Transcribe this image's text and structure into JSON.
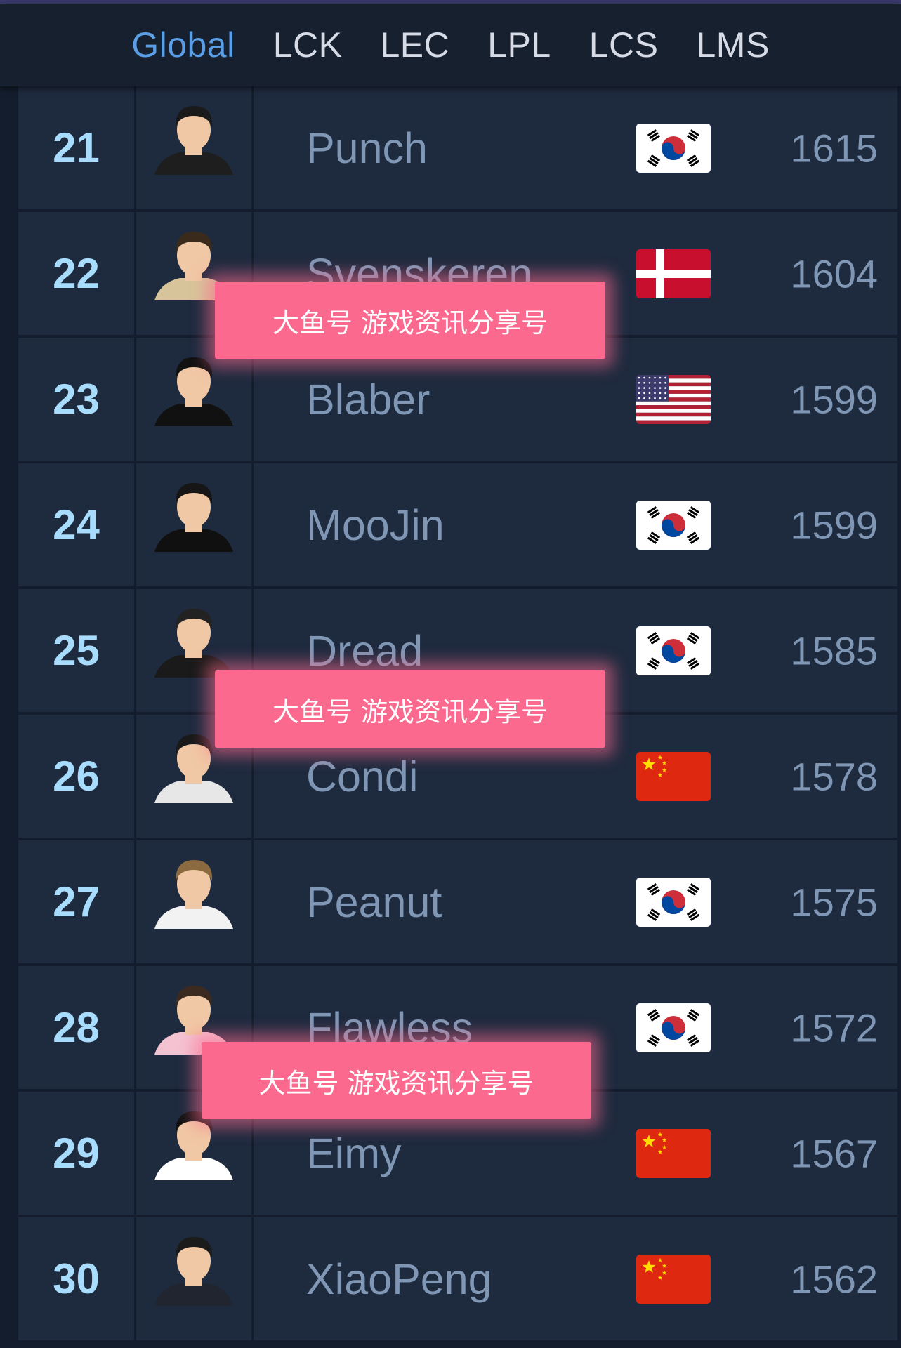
{
  "tabs": [
    {
      "label": "Global",
      "active": true
    },
    {
      "label": "LCK"
    },
    {
      "label": "LEC"
    },
    {
      "label": "LPL"
    },
    {
      "label": "LCS"
    },
    {
      "label": "LMS"
    }
  ],
  "players": [
    {
      "rank": "21",
      "name": "Punch",
      "flag": "korea",
      "elo": "1615"
    },
    {
      "rank": "22",
      "name": "Svenskeren",
      "flag": "denmark",
      "elo": "1604"
    },
    {
      "rank": "23",
      "name": "Blaber",
      "flag": "usa",
      "elo": "1599"
    },
    {
      "rank": "24",
      "name": "MooJin",
      "flag": "korea",
      "elo": "1599"
    },
    {
      "rank": "25",
      "name": "Dread",
      "flag": "korea",
      "elo": "1585"
    },
    {
      "rank": "26",
      "name": "Condi",
      "flag": "china",
      "elo": "1578"
    },
    {
      "rank": "27",
      "name": "Peanut",
      "flag": "korea",
      "elo": "1575"
    },
    {
      "rank": "28",
      "name": "Flawless",
      "flag": "korea",
      "elo": "1572"
    },
    {
      "rank": "29",
      "name": "Eimy",
      "flag": "china",
      "elo": "1567"
    },
    {
      "rank": "30",
      "name": "XiaoPeng",
      "flag": "china",
      "elo": "1562"
    }
  ],
  "watermark": "大鱼号 游戏资讯分享号",
  "colors": {
    "background": "#141d2d",
    "row_bg": "#1e2a3e",
    "tab_active": "#5a9ee6",
    "rank_text": "#a8dcfc",
    "watermark_bg": "#fb6a8e"
  }
}
